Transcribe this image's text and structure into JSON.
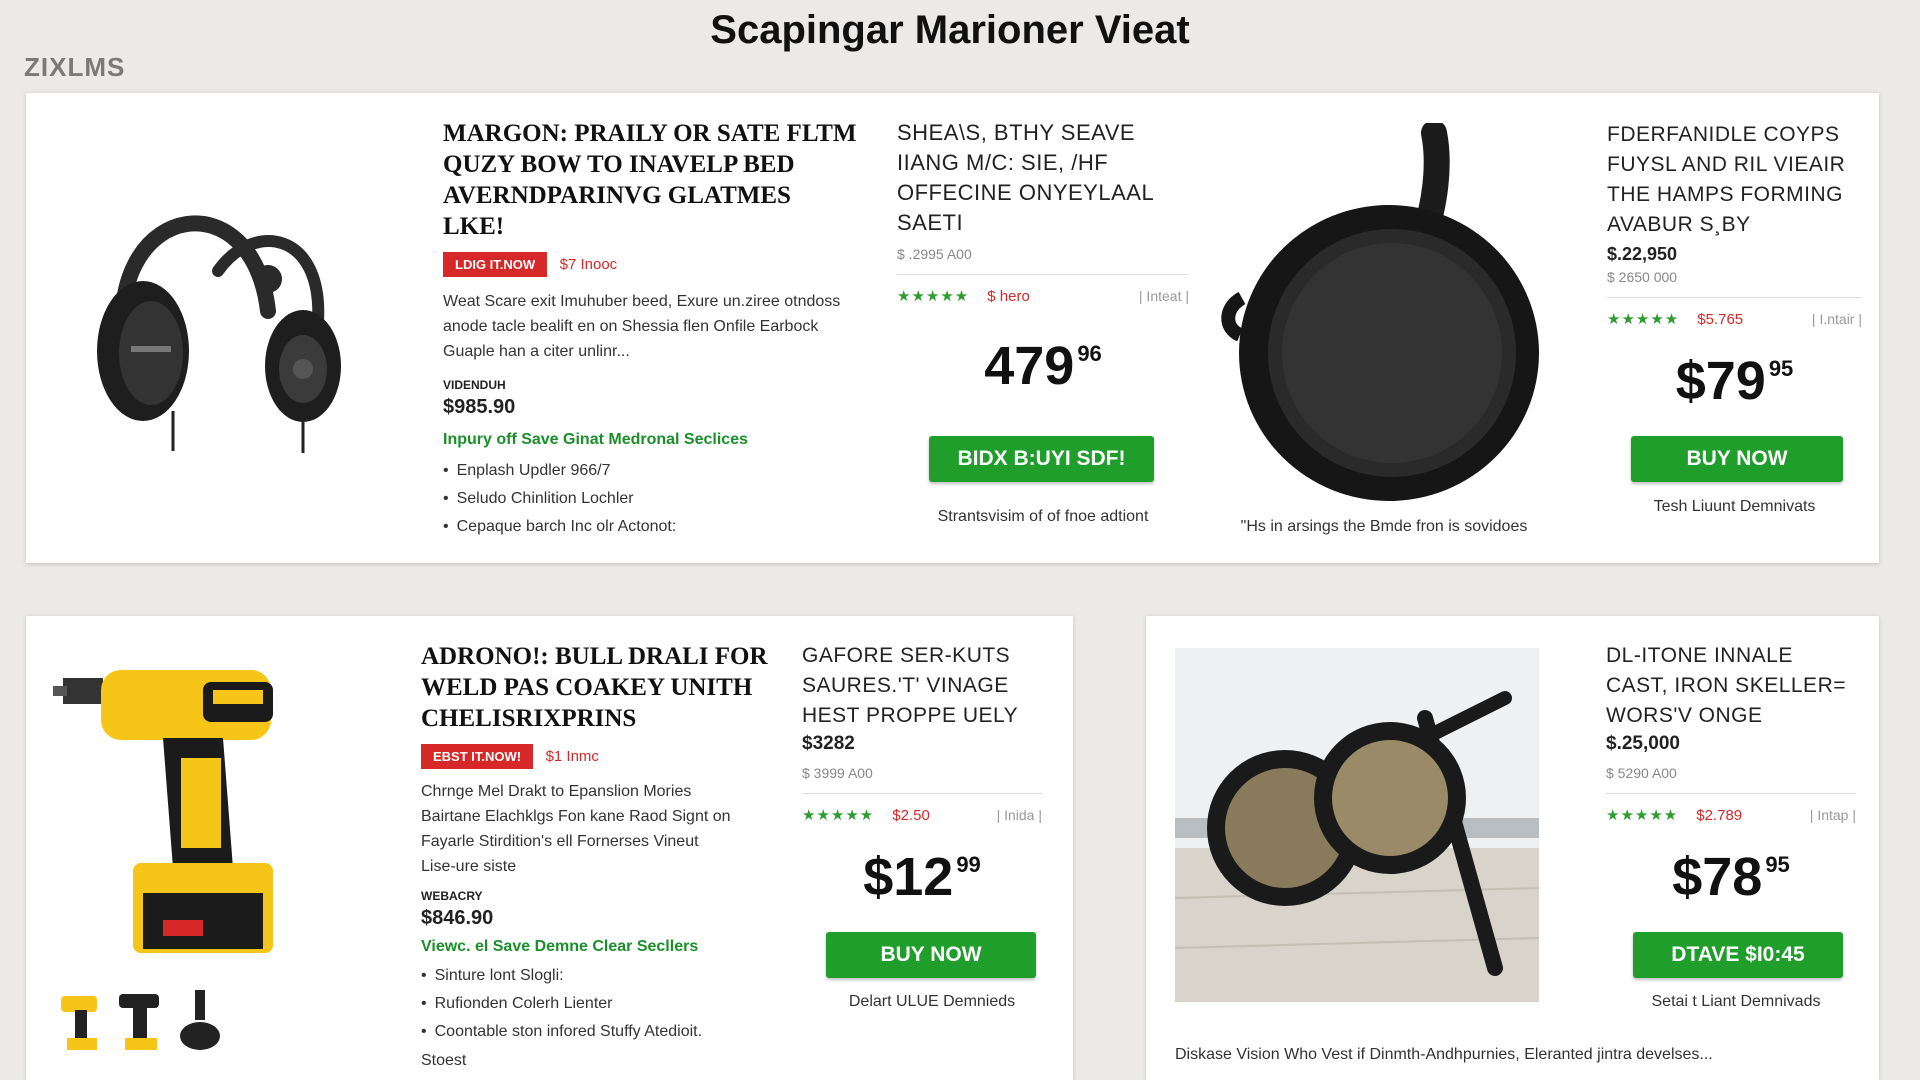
{
  "page": {
    "title": "Scapingar Marioner Vieat",
    "brand": "ΖΙΧLMS"
  },
  "colors": {
    "accent_green": "#1f9e2b",
    "badge_red": "#d62828",
    "background": "#ebeae8"
  },
  "top_card": {
    "headphones": {
      "image_icon": "headphones-icon",
      "title_lines": [
        "MARGON: PRAILY OR SATE FLTM",
        "QUZY BOW TO INAVELP BED",
        "AVERNDPARINVG GLATMES",
        "LKE!"
      ],
      "badge": "LDIG IT.NOW",
      "badge_note": "$7 Inooc",
      "description_lines": [
        "Weat Scare exit Imuhuber beed, Exure un.ziree otndoss",
        "anode tacle bealift en on Shessia flen Onfile Earbock",
        "Guaple han a citer unlinr..."
      ],
      "price_label": "VIDENDUH",
      "price": "$985.90",
      "offer": "Inpury off Save Ginat Medronal Seclices",
      "bullets": [
        "Enplash Updler 966/7",
        "Seludo Chinlition Lochler",
        "Cepaque barch Inc olr Actonot:"
      ]
    },
    "middle": {
      "title_lines": [
        "SHEA\\S, BTHY SEAVE",
        "IIANG M/C: SIE, /HF",
        "OFFECINE ONYEYLAAL",
        "SAETI"
      ],
      "old_price": "$ .2995 A00",
      "stars": "★★★★★",
      "rating_value": "$ hero",
      "rating_info": "| Inteat |",
      "price_main": "479",
      "price_cents": "96",
      "button_label": "BIDX B:UYI SDF!",
      "under_button": "Strantsvisim of of fnoe adtiont"
    },
    "skillet": {
      "image_icon": "skillet-icon",
      "caption": "\"Hs in arsings the Bmde fron is sovidoes"
    },
    "right": {
      "title_lines": [
        "FDERFANIDLE COYPS",
        "FUYSL AND RIL VIEAIR",
        "THE HAMPS FORMING",
        "AVABUR S¸BY"
      ],
      "price": "$.22,950",
      "old_price": "$ 2650 000",
      "stars": "★★★★★",
      "rating_value": "$5.765",
      "rating_info": "| I.ntair |",
      "price_main": "$79",
      "price_cents": "95",
      "button_label": "BUY NOW",
      "under_button": "Tesh Liuunt Demnivats"
    }
  },
  "bottom_left_card": {
    "drill": {
      "image_icon": "power-drill-icon",
      "thumbnail_icons": [
        "drill-thumbnail-icon",
        "drill-set-thumbnail-icon",
        "drill-case-thumbnail-icon"
      ],
      "title_lines": [
        "ADRONO!: BULL DRALI FOR",
        "WELD PAS COAKEY UNITH",
        "CHELISRIXPRINS"
      ],
      "badge": "EBST IT.NOW!",
      "badge_note": "$1 Inmc",
      "description_lines": [
        "Chrnge Mel Drakt to Epanslion Mories",
        "Bairtane Elachklgs Fon kane Raod Signt on",
        "Fayarle Stirdition's ell Fornerses Vineut",
        "Lise-ure siste"
      ],
      "price_label": "WEBACRY",
      "price": "$846.90",
      "offer": "Viewc. el Save Demne Clear Secllers",
      "bullets": [
        "Sinture lont Slogli:",
        "Rufionden Colerh Lienter",
        "Coontable ston infored Stuffy Atedioit."
      ],
      "footer": "Stoest"
    },
    "middle": {
      "title_lines": [
        "GAFORE SER-KUTS",
        "SAURES.'T' VINAGE",
        "HEST PROPPE UELY"
      ],
      "price": "$3282",
      "old_price": "$ 3999 A00",
      "stars": "★★★★★",
      "rating_value": "$2.50",
      "rating_info": "| Inida |",
      "price_main": "$12",
      "price_cents": "99",
      "button_label": "BUY NOW",
      "under_button": "Delart ULUE Demnieds"
    }
  },
  "bottom_right_card": {
    "image_icon": "cast-iron-skillet-pair-icon",
    "title_lines": [
      "DL-ITONE INNALE",
      "CAST, IRON SKELLER=",
      "WORS'V ONGE"
    ],
    "price": "$.25,000",
    "old_price": "$ 5290 A00",
    "stars": "★★★★★",
    "rating_value": "$2.789",
    "rating_info": "| Intap |",
    "price_main": "$78",
    "price_cents": "95",
    "button_label": "DTAVE $I0:45",
    "under_button": "Setai t Liant Demnivads",
    "caption": "Diskase Vision Who Vest if Dinmth-Andhpurnies, Eleranted jintra develses..."
  }
}
